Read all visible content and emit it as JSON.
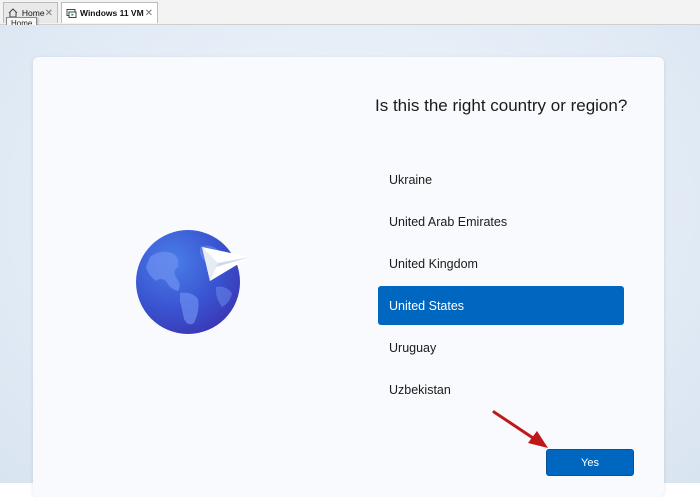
{
  "tabs": [
    {
      "label": "Home",
      "icon": "home-icon",
      "close": "✕"
    },
    {
      "label": "Windows 11 VM",
      "icon": "vm-icon",
      "close": "✕"
    }
  ],
  "tooltip": "Home",
  "oobe": {
    "heading": "Is this the right country or region?",
    "countries": [
      "Ukraine",
      "United Arab Emirates",
      "United Kingdom",
      "United States",
      "Uruguay",
      "Uzbekistan"
    ],
    "selected": "United States",
    "yes_label": "Yes"
  },
  "colors": {
    "accent": "#0067c0",
    "annotation_arrow": "#c0171c",
    "globe": "#3f58d4"
  }
}
